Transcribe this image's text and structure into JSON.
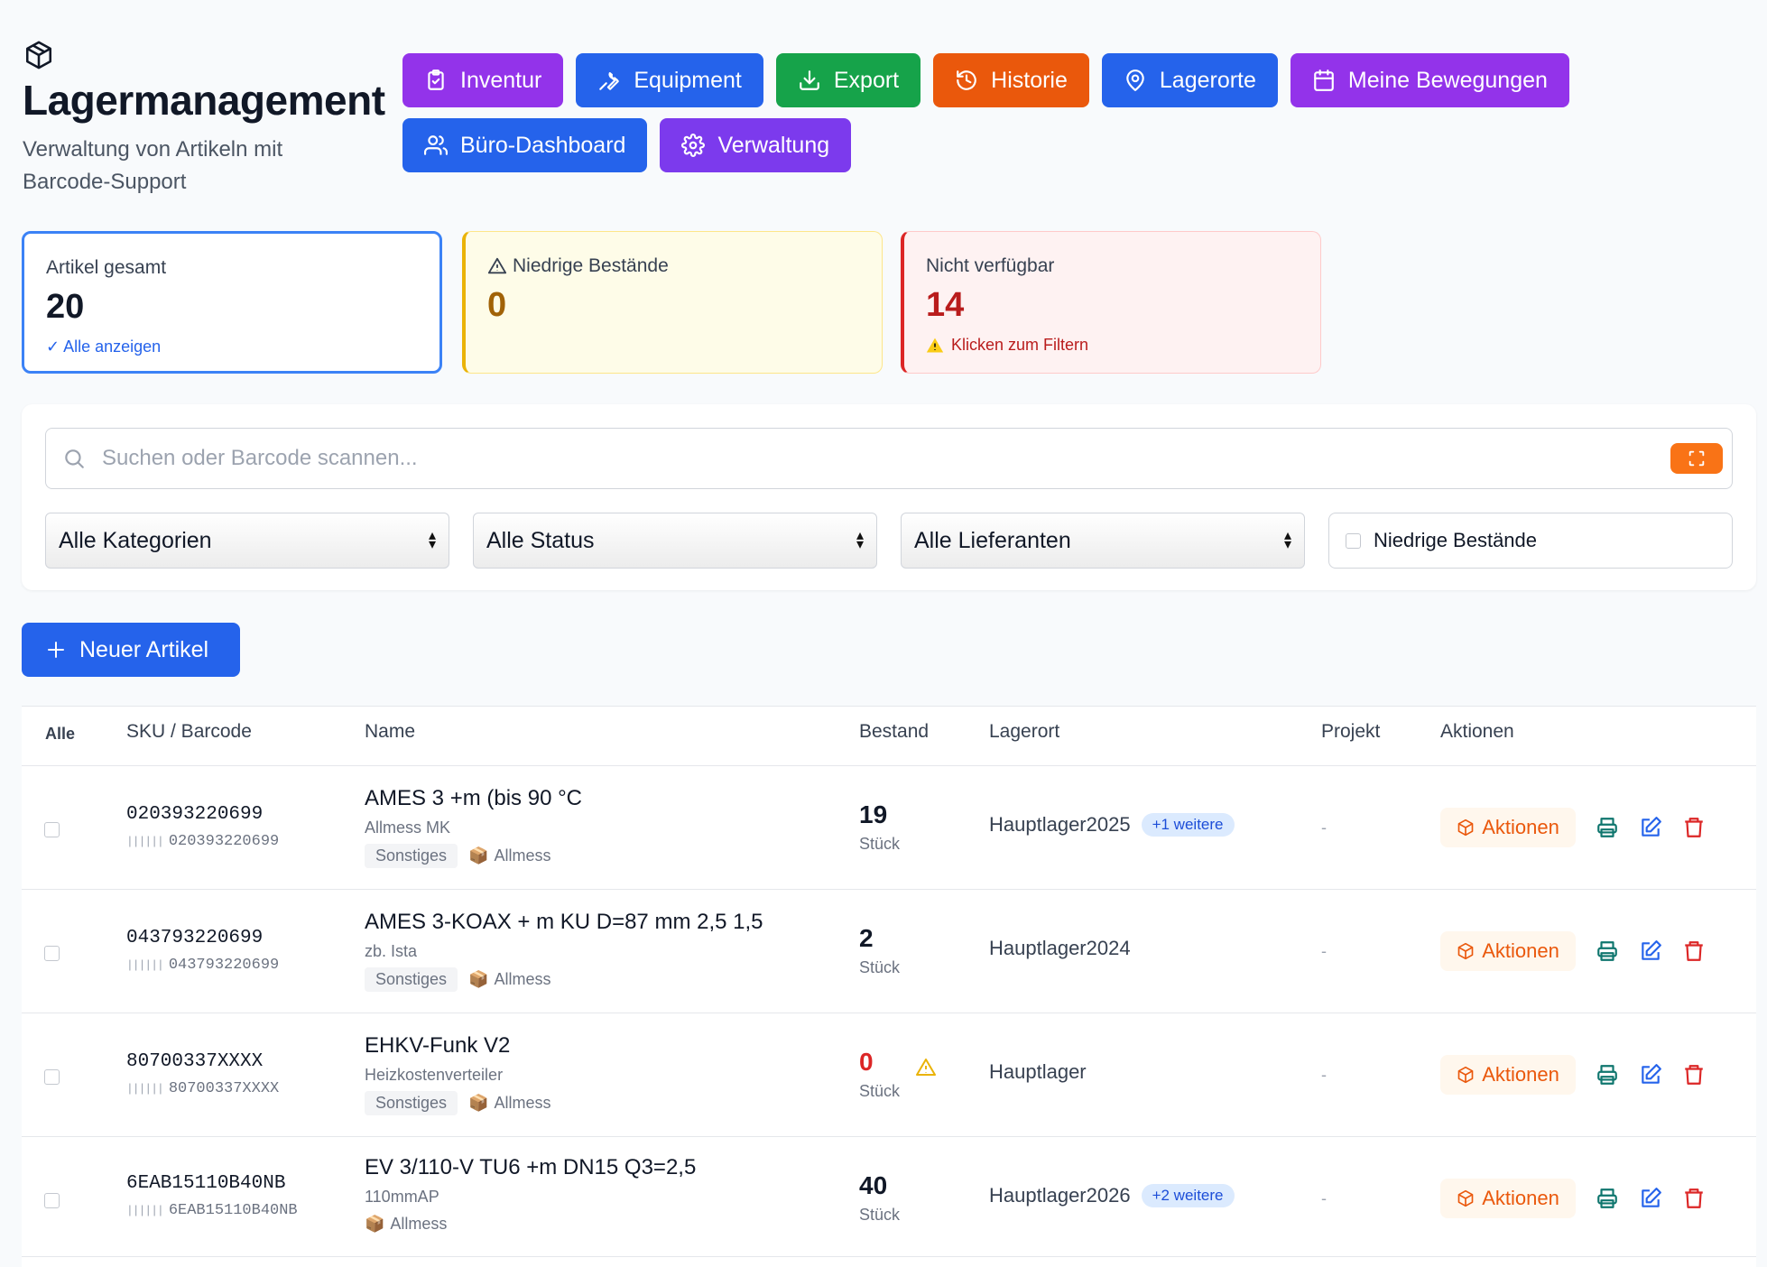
{
  "header": {
    "title": "Lagermanagement",
    "subtitle": "Verwaltung von Artikeln mit Barcode-Support",
    "logo_icon": "package-icon"
  },
  "nav": [
    {
      "label": "Inventur",
      "icon": "clipboard-check-icon",
      "color": "#9333ea"
    },
    {
      "label": "Equipment",
      "icon": "wrench-icon",
      "color": "#2563eb"
    },
    {
      "label": "Export",
      "icon": "download-icon",
      "color": "#16a34a"
    },
    {
      "label": "Historie",
      "icon": "history-icon",
      "color": "#ea580c"
    },
    {
      "label": "Lagerorte",
      "icon": "map-pin-icon",
      "color": "#2563eb"
    },
    {
      "label": "Meine Bewegungen",
      "icon": "calendar-icon",
      "color": "#9333ea"
    },
    {
      "label": "Büro-Dashboard",
      "icon": "users-icon",
      "color": "#2563eb"
    },
    {
      "label": "Verwaltung",
      "icon": "gear-icon",
      "color": "#7c3aed"
    }
  ],
  "stats": {
    "total": {
      "label": "Artikel gesamt",
      "value": "20",
      "hint": "✓ Alle anzeigen"
    },
    "low": {
      "label": "Niedrige Bestände",
      "value": "0"
    },
    "unavailable": {
      "label": "Nicht verfügbar",
      "value": "14",
      "hint": "Klicken zum Filtern"
    }
  },
  "filters": {
    "search_placeholder": "Suchen oder Barcode scannen...",
    "category": "Alle Kategorien",
    "status": "Alle Status",
    "supplier": "Alle Lieferanten",
    "low_stock_label": "Niedrige Bestände"
  },
  "new_item_label": "Neuer Artikel",
  "table": {
    "headers": {
      "all": "Alle",
      "sku": "SKU / Barcode",
      "name": "Name",
      "stock": "Bestand",
      "location": "Lagerort",
      "project": "Projekt",
      "actions": "Aktionen"
    },
    "rows": [
      {
        "sku": "020393220699",
        "barcode": "020393220699",
        "name": "AMES 3 +m (bis 90 °C",
        "desc": "Allmess MK",
        "category": "Sonstiges",
        "supplier": "Allmess",
        "qty": "19",
        "unit": "Stück",
        "location": "Hauptlager2025",
        "more": "+1 weitere",
        "project": "-",
        "action": "Aktionen"
      },
      {
        "sku": "043793220699",
        "barcode": "043793220699",
        "name": "AMES 3-KOAX + m KU D=87 mm 2,5 1,5",
        "desc": "zb. Ista",
        "category": "Sonstiges",
        "supplier": "Allmess",
        "qty": "2",
        "unit": "Stück",
        "location": "Hauptlager2024",
        "more": "",
        "project": "-",
        "action": "Aktionen"
      },
      {
        "sku": "80700337XXXX",
        "barcode": "80700337XXXX",
        "name": "EHKV-Funk V2",
        "desc": "Heizkostenverteiler",
        "category": "Sonstiges",
        "supplier": "Allmess",
        "qty": "0",
        "unit": "Stück",
        "location": "Hauptlager",
        "more": "",
        "project": "-",
        "action": "Aktionen"
      },
      {
        "sku": "6EAB15110B40NB",
        "barcode": "6EAB15110B40NB",
        "name": "EV 3/110-V TU6 +m DN15 Q3=2,5",
        "desc": "110mmAP",
        "category": "",
        "supplier": "Allmess",
        "qty": "40",
        "unit": "Stück",
        "location": "Hauptlager2026",
        "more": "+2 weitere",
        "project": "-",
        "action": "Aktionen"
      }
    ]
  }
}
